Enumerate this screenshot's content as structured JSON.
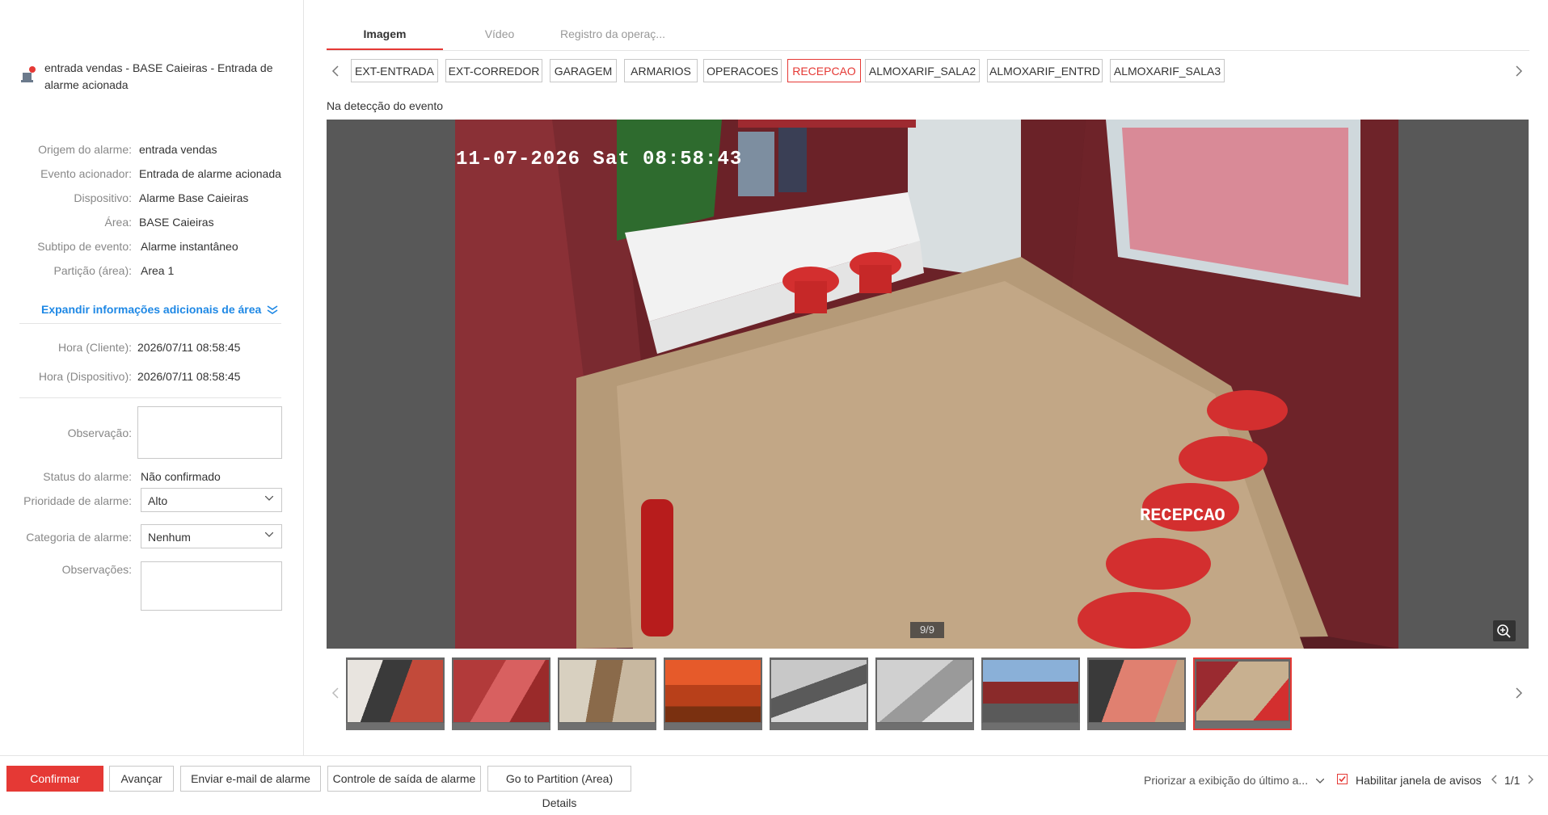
{
  "alarm": {
    "title": "entrada vendas - BASE Caieiras - Entrada de alarme acionada"
  },
  "details": [
    {
      "label": "Origem do alarme:",
      "value": "entrada vendas"
    },
    {
      "label": "Evento acionador:",
      "value": "Entrada de alarme acionada"
    },
    {
      "label": "Dispositivo:",
      "value": "Alarme Base Caieiras"
    },
    {
      "label": "Área:",
      "value": "BASE Caieiras"
    },
    {
      "label": "Subtipo de evento:",
      "value": "Alarme instantâneo"
    },
    {
      "label": "Partição (área):",
      "value": "Area 1"
    }
  ],
  "expand_link": "Expandir informações adicionais de área",
  "times": [
    {
      "label": "Hora (Cliente):",
      "value": "2026/07/11 08:58:45"
    },
    {
      "label": "Hora (Dispositivo):",
      "value": "2026/07/11 08:58:45"
    }
  ],
  "form": {
    "observacao_label": "Observação:",
    "status_label": "Status do alarme:",
    "status_value": "Não confirmado",
    "priority_label": "Prioridade de alarme:",
    "priority_value": "Alto",
    "category_label": "Categoria de alarme:",
    "category_value": "Nenhum",
    "observacoes_label": "Observações:"
  },
  "tabs": [
    "Imagem",
    "Vídeo",
    "Registro da operaç..."
  ],
  "cameras": [
    "EXT-ENTRADA",
    "EXT-CORREDOR",
    "GARAGEM",
    "ARMARIOS",
    "OPERACOES",
    "RECEPCAO",
    "ALMOXARIF_SALA2",
    "ALMOXARIF_ENTRD",
    "ALMOXARIF_SALA3"
  ],
  "active_camera": "RECEPCAO",
  "caption": "Na detecção do evento",
  "osd": {
    "datetime": "11-07-2026 Sat 08:58:43",
    "camera_name": "RECEPCAO"
  },
  "counter": "9/9",
  "thumbnails_count": 9,
  "active_thumbnail": 9,
  "footer": {
    "confirm": "Confirmar",
    "next": "Avançar",
    "email": "Enviar e-mail de alarme",
    "output": "Controle de saída de alarme",
    "partition": "Go to Partition (Area) Details",
    "priority_select": "Priorizar a exibição do último a...",
    "enable_popup": "Habilitar janela de avisos",
    "pager": "1/1"
  },
  "colors": {
    "accent": "#e53935",
    "link": "#1e88e5"
  }
}
